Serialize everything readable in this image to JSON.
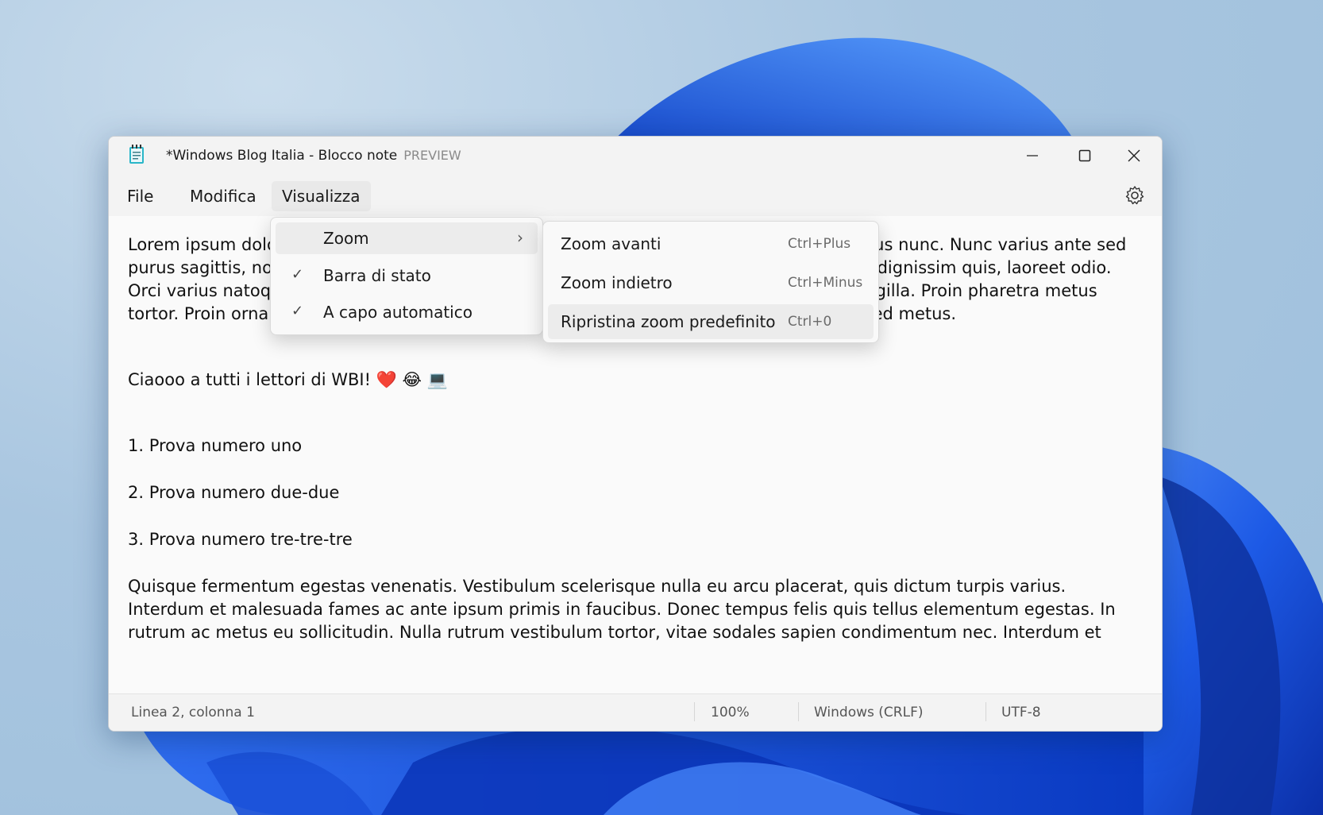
{
  "window": {
    "title": "*Windows Blog Italia - Blocco note",
    "title_badge": "PREVIEW"
  },
  "menubar": {
    "items": [
      "File",
      "Modifica",
      "Visualizza"
    ],
    "active": "Visualizza"
  },
  "view_menu": {
    "items": [
      {
        "label": "Zoom",
        "checked": false,
        "submenu": true
      },
      {
        "label": "Barra di stato",
        "checked": true,
        "submenu": false
      },
      {
        "label": "A capo automatico",
        "checked": true,
        "submenu": false
      }
    ]
  },
  "zoom_submenu": {
    "items": [
      {
        "label": "Zoom avanti",
        "shortcut": "Ctrl+Plus"
      },
      {
        "label": "Zoom indietro",
        "shortcut": "Ctrl+Minus"
      },
      {
        "label": "Ripristina zoom predefinito",
        "shortcut": "Ctrl+0"
      }
    ]
  },
  "editor": {
    "paragraph1": "Lorem ipsum dolor sit amet, consectetur adipiscing elit. Sed pharetra sem quis, ac faucibus nunc. Nunc varius ante sed purus sagittis, non hendrerit metus. Suspendisse maximus vestibulum est, in luctus ante dignissim quis, laoreet odio. Orci varius natoque penatibus et magnis dis, vitae ornare diam. Morbi facilisis aliquet fringilla. Proin pharetra metus tortor. Proin ornare non mi eu imperdiet. Nullam ante elit, aliquet a cursus id, imperdiet sed metus.",
    "greeting": "Ciaooo a tutti i lettori di WBI! ❤️ 😂 💻",
    "list1": "1. Prova numero uno",
    "list2": "2. Prova numero due-due",
    "list3": "3. Prova numero tre-tre-tre",
    "paragraph2": "Quisque fermentum egestas venenatis. Vestibulum scelerisque nulla eu arcu placerat, quis dictum turpis varius. Interdum et malesuada fames ac ante ipsum primis in faucibus. Donec tempus felis quis tellus elementum egestas. In rutrum ac metus eu sollicitudin. Nulla rutrum vestibulum tortor, vitae sodales sapien condimentum nec. Interdum et"
  },
  "statusbar": {
    "position": "Linea 2, colonna 1",
    "zoom": "100%",
    "line_ending": "Windows (CRLF)",
    "encoding": "UTF-8"
  }
}
